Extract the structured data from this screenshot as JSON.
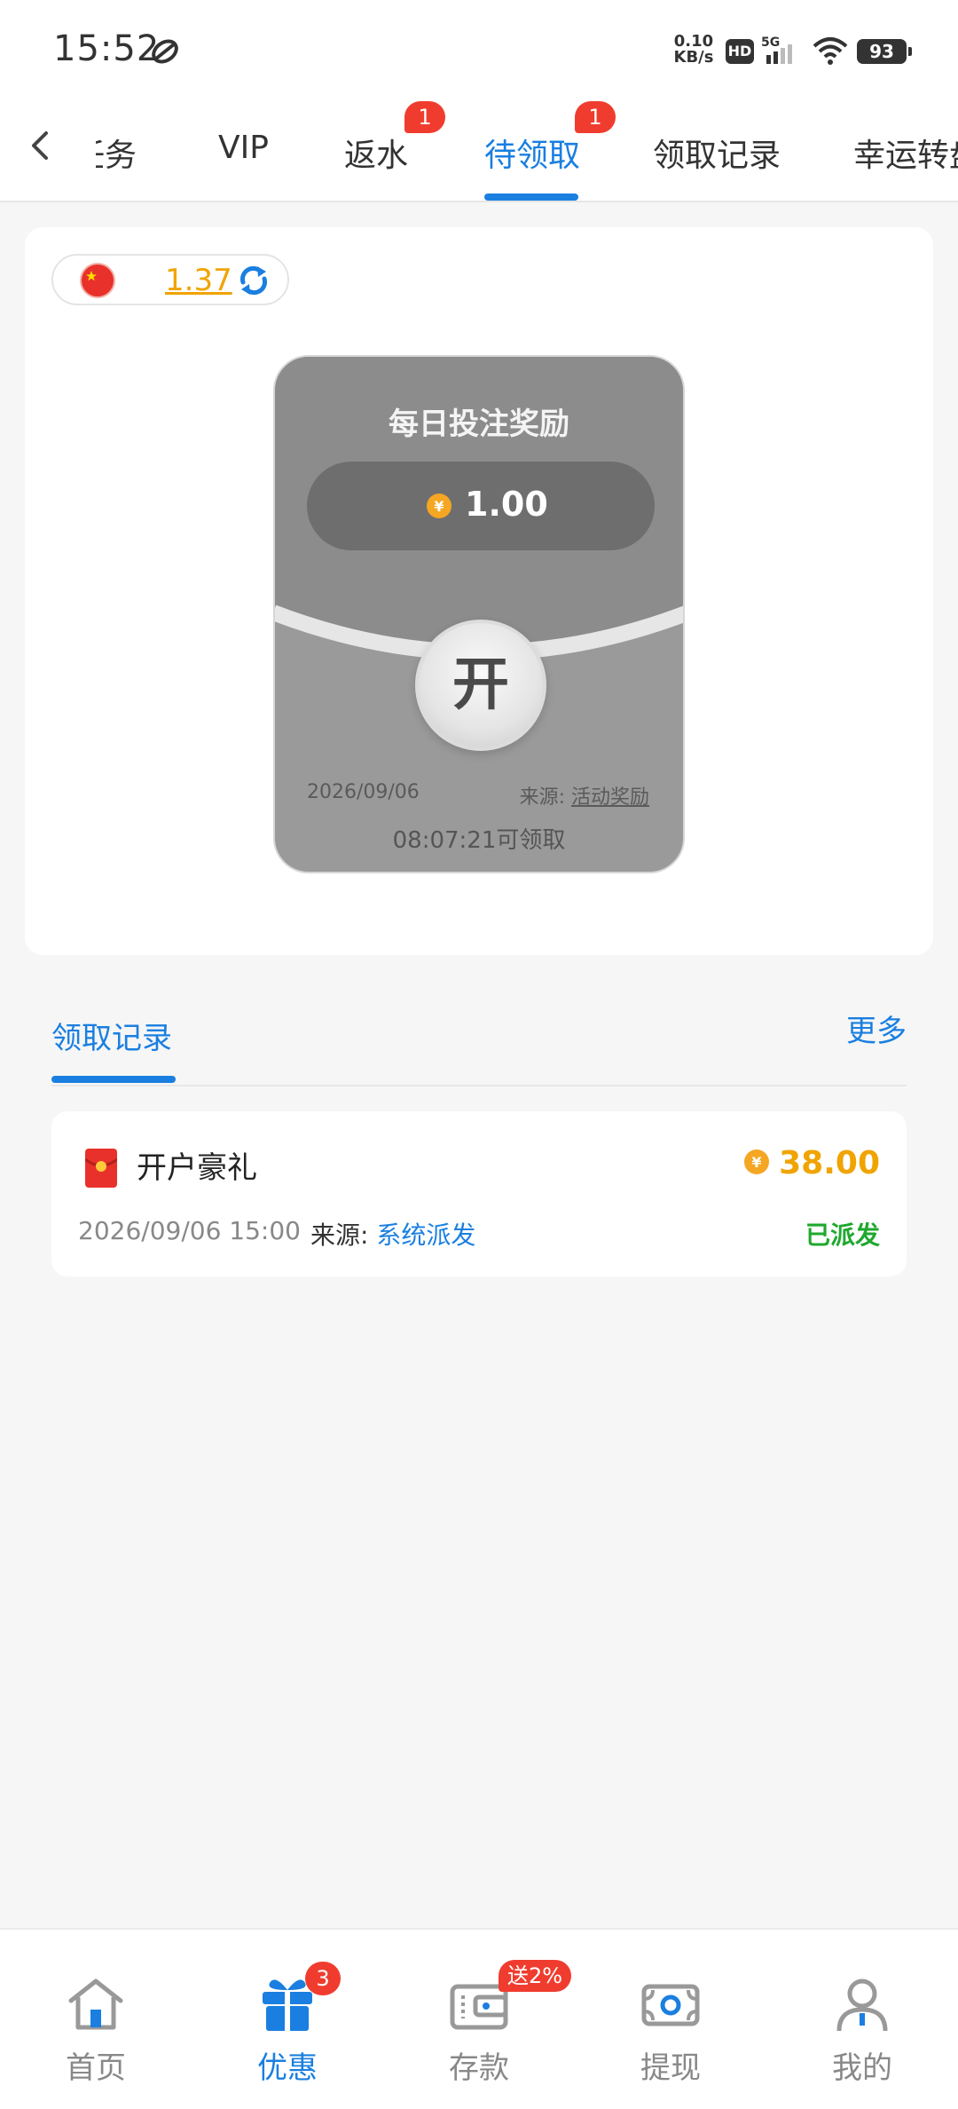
{
  "status_bar": {
    "time": "15:52",
    "net_speed_value": "0.10",
    "net_speed_unit": "KB/s",
    "hd": "HD",
    "network": "5G",
    "battery": "93"
  },
  "tabs": {
    "items": [
      {
        "label": "任务"
      },
      {
        "label": "VIP"
      },
      {
        "label": "返水",
        "badge": "1"
      },
      {
        "label": "待领取",
        "badge": "1"
      },
      {
        "label": "领取记录"
      },
      {
        "label": "幸运转盘"
      }
    ],
    "active_index": 3
  },
  "balance": {
    "value": "1.37"
  },
  "envelope": {
    "title": "每日投注奖励",
    "amount": "1.00",
    "open_label": "开",
    "date": "2026/09/06",
    "source_label": "来源:",
    "source_value": "活动奖励",
    "countdown": "08:07:21可领取"
  },
  "records": {
    "title": "领取记录",
    "more": "更多",
    "items": [
      {
        "name": "开户豪礼",
        "amount": "38.00",
        "time": "2026/09/06 15:00",
        "source_label": "来源:",
        "source_value": "系统派发",
        "status": "已派发"
      }
    ]
  },
  "bottom_nav": {
    "items": [
      {
        "label": "首页",
        "icon": "home-icon"
      },
      {
        "label": "优惠",
        "icon": "gift-icon",
        "badge": "3"
      },
      {
        "label": "存款",
        "icon": "wallet-icon",
        "promo": "送2%"
      },
      {
        "label": "提现",
        "icon": "cash-icon"
      },
      {
        "label": "我的",
        "icon": "user-icon"
      }
    ],
    "active_index": 1
  },
  "colors": {
    "accent": "#1a7fe0",
    "badge": "#f03c2e",
    "gold": "#f0a400",
    "success": "#1fa82e"
  }
}
